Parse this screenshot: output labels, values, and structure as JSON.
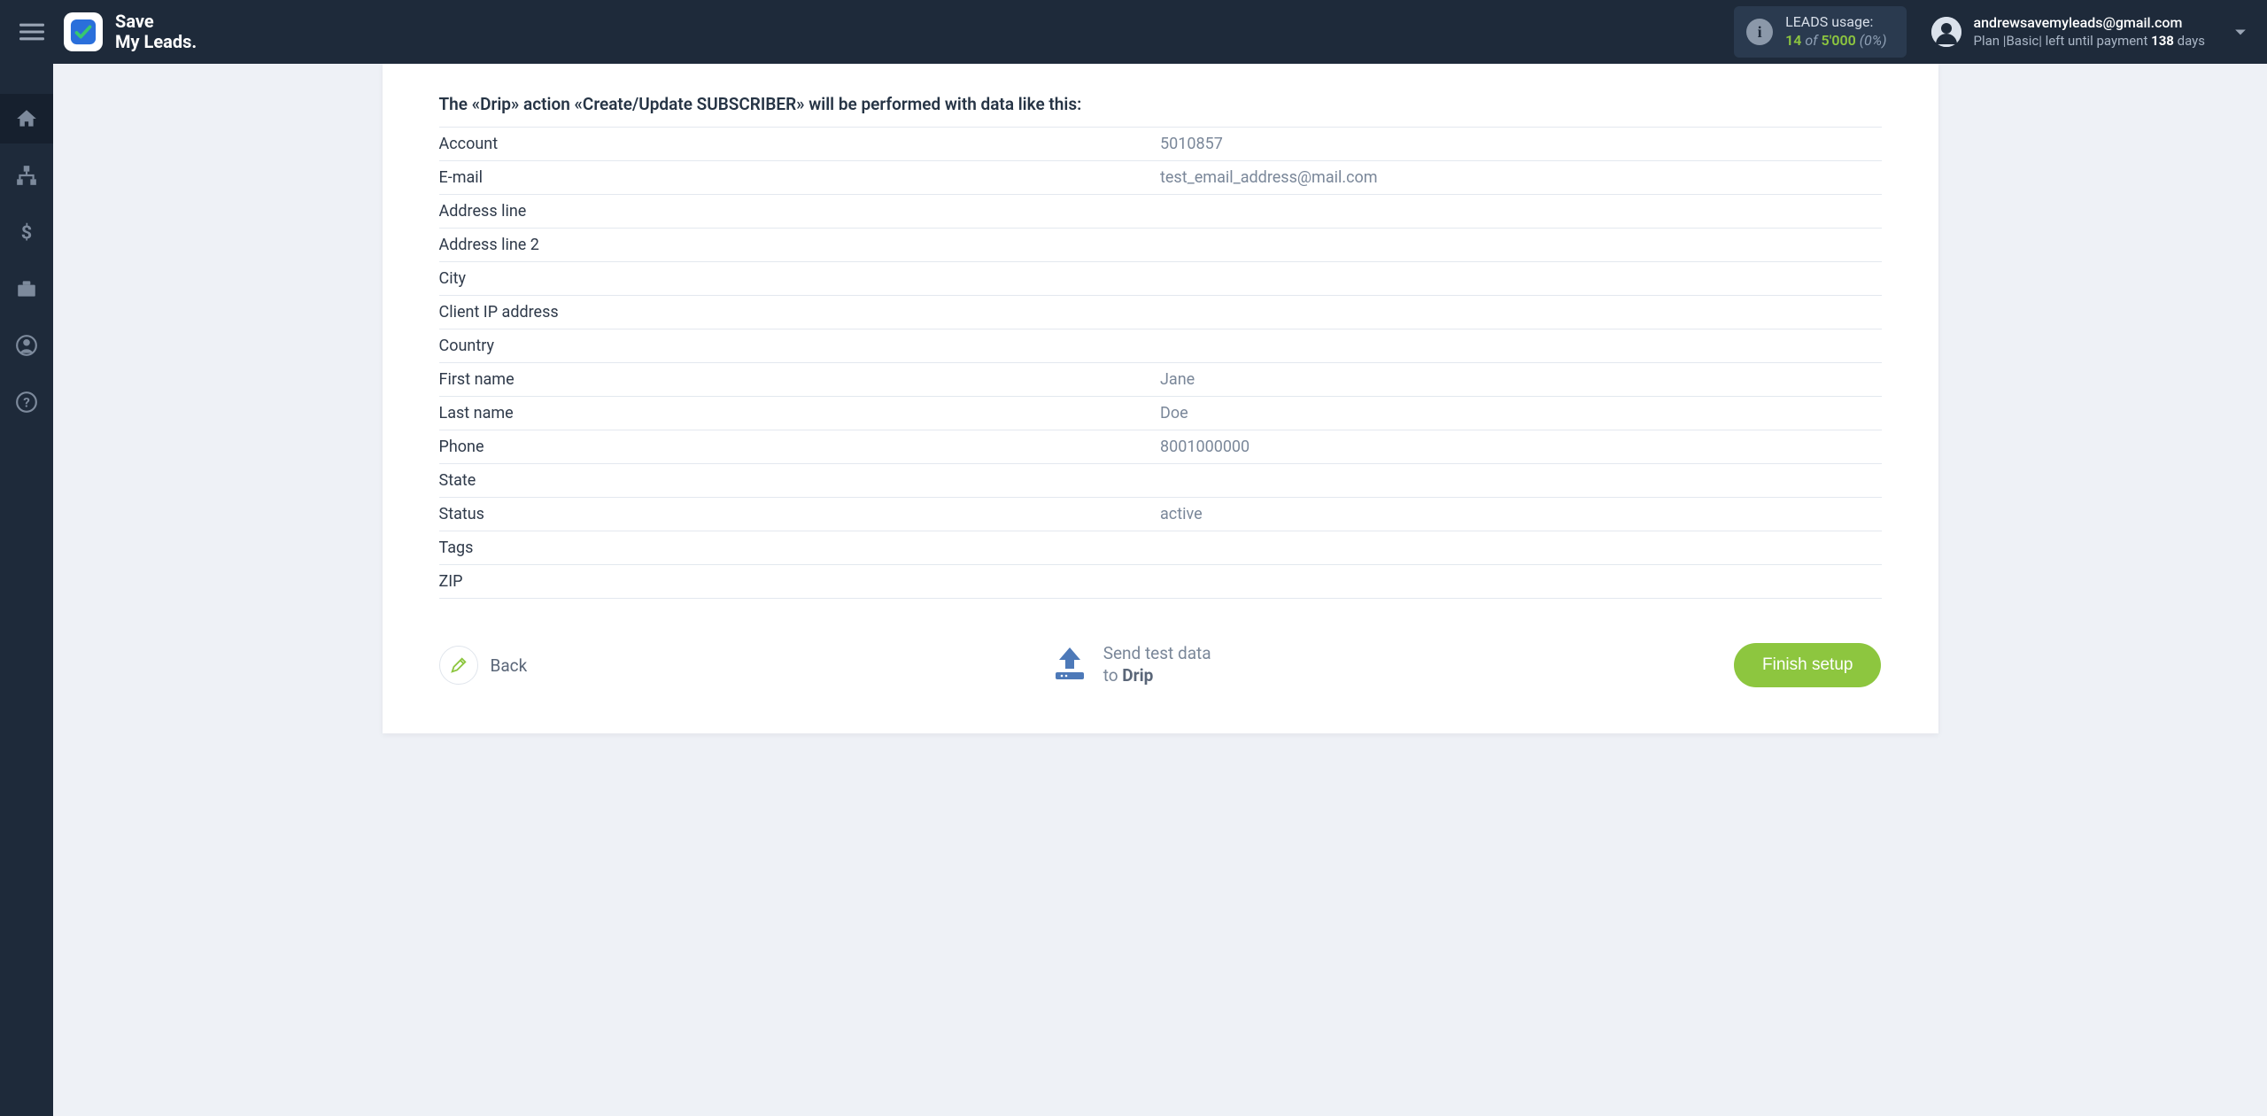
{
  "brand": {
    "line1": "Save",
    "line2": "My Leads."
  },
  "usage": {
    "title": "LEADS usage:",
    "used": "14",
    "of": "of",
    "total": "5'000",
    "pct": "(0%)"
  },
  "account": {
    "email": "andrewsavemyleads@gmail.com",
    "plan_prefix": "Plan |Basic| left until payment ",
    "days_num": "138",
    "days_suffix": " days"
  },
  "preview": {
    "heading": "The «Drip» action «Create/Update SUBSCRIBER» will be performed with data like this:",
    "rows": [
      {
        "label": "Account",
        "value": "5010857"
      },
      {
        "label": "E-mail",
        "value": "test_email_address@mail.com"
      },
      {
        "label": "Address line",
        "value": ""
      },
      {
        "label": "Address line 2",
        "value": ""
      },
      {
        "label": "City",
        "value": ""
      },
      {
        "label": "Client IP address",
        "value": ""
      },
      {
        "label": "Country",
        "value": ""
      },
      {
        "label": "First name",
        "value": "Jane"
      },
      {
        "label": "Last name",
        "value": "Doe"
      },
      {
        "label": "Phone",
        "value": "8001000000"
      },
      {
        "label": "State",
        "value": ""
      },
      {
        "label": "Status",
        "value": "active"
      },
      {
        "label": "Tags",
        "value": ""
      },
      {
        "label": "ZIP",
        "value": ""
      }
    ]
  },
  "footer": {
    "back": "Back",
    "send_line1": "Send test data",
    "send_line2_prefix": "to ",
    "send_line2_bold": "Drip",
    "finish": "Finish setup"
  }
}
